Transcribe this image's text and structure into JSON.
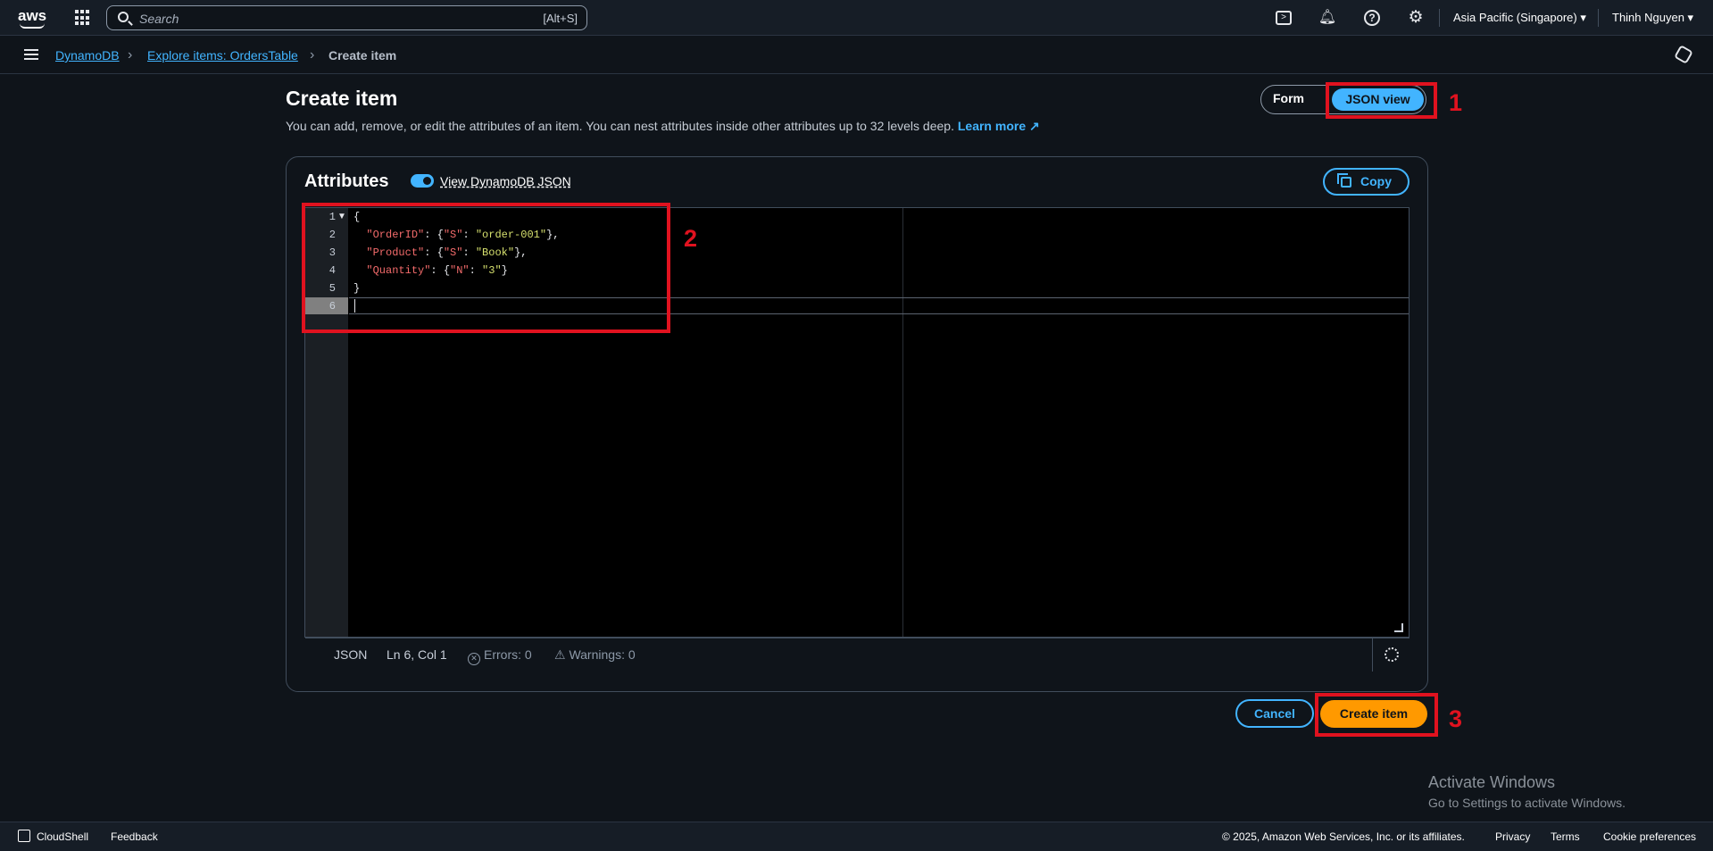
{
  "topbar": {
    "logo_text": "aws",
    "search_placeholder": "Search",
    "search_shortcut": "[Alt+S]",
    "region": "Asia Pacific (Singapore) ▾",
    "user": "Thinh Nguyen ▾"
  },
  "breadcrumb": {
    "items": [
      "DynamoDB",
      "Explore items: OrdersTable",
      "Create item"
    ]
  },
  "page": {
    "title": "Create item",
    "description": "You can add, remove, or edit the attributes of an item. You can nest attributes inside other attributes up to 32 levels deep.",
    "learn_more": "Learn more"
  },
  "view_toggle": {
    "form_label": "Form",
    "json_label": "JSON view",
    "selected": "JSON view"
  },
  "annotations": {
    "one": "1",
    "two": "2",
    "three": "3"
  },
  "attributes": {
    "heading": "Attributes",
    "toggle_label": "View DynamoDB JSON",
    "toggle_on": true,
    "copy_label": "Copy"
  },
  "editor": {
    "line_numbers": [
      "1",
      "2",
      "3",
      "4",
      "5",
      "6"
    ],
    "lines": [
      "{",
      "  \"OrderID\": {\"S\": \"order-001\"},",
      "  \"Product\": {\"S\": \"Book\"},",
      "  \"Quantity\": {\"N\": \"3\"}",
      "}",
      ""
    ]
  },
  "status_bar": {
    "language": "JSON",
    "position": "Ln 6, Col 1",
    "errors": "Errors: 0",
    "warnings": "Warnings: 0"
  },
  "actions": {
    "cancel": "Cancel",
    "create": "Create item"
  },
  "watermark": {
    "line1": "Activate Windows",
    "line2": "Go to Settings to activate Windows."
  },
  "footer": {
    "cloudshell": "CloudShell",
    "feedback": "Feedback",
    "copyright": "© 2025, Amazon Web Services, Inc. or its affiliates.",
    "privacy": "Privacy",
    "terms": "Terms",
    "cookies": "Cookie preferences"
  },
  "colors": {
    "accent": "#42b4ff",
    "primary_button": "#ff9900",
    "annotation": "#e0121f"
  }
}
